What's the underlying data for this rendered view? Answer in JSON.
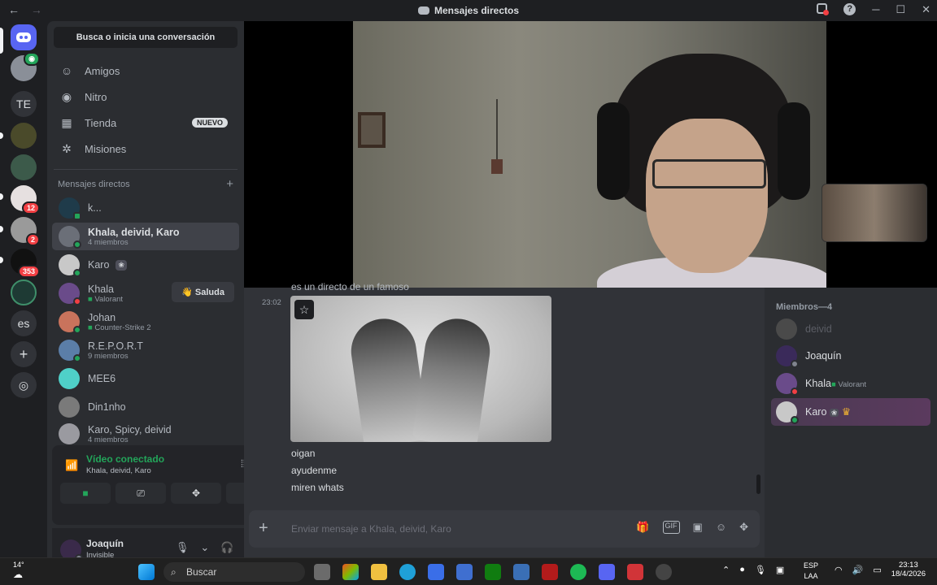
{
  "titlebar": {
    "back": "←",
    "forward": "→",
    "title": "Mensajes directos",
    "help": "?",
    "minimize": "─",
    "maximize": "☐",
    "close": "✕"
  },
  "rail": {
    "te": "TE",
    "es": "es",
    "badges": [
      "12",
      "2",
      "353"
    ],
    "add": "+",
    "explore": "◎"
  },
  "sidebar": {
    "search": "Busca o inicia una conversación",
    "nav": [
      {
        "label": "Amigos",
        "icon": "friends-icon"
      },
      {
        "label": "Nitro",
        "icon": "nitro-icon"
      },
      {
        "label": "Tienda",
        "icon": "shop-icon",
        "tag": "NUEVO"
      },
      {
        "label": "Misiones",
        "icon": "quests-icon"
      }
    ],
    "dm_header": "Mensajes directos",
    "dm_add": "+",
    "dms": [
      {
        "name": "k...",
        "sub": ""
      },
      {
        "name": "Khala, deivid, Karo",
        "sub": "4 miembros"
      },
      {
        "name": "Karo",
        "sub": ""
      },
      {
        "name": "Khala",
        "sub": "Valorant",
        "action": "Saluda"
      },
      {
        "name": "Johan",
        "sub": "Counter-Strike 2"
      },
      {
        "name": "R.E.P.O.R.T",
        "sub": "9 miembros"
      },
      {
        "name": "MEE6",
        "sub": ""
      },
      {
        "name": "Din1nho",
        "sub": ""
      },
      {
        "name": "Karo, Spicy, deivid",
        "sub": "4 miembros"
      }
    ],
    "wave_emoji": "👋"
  },
  "voice": {
    "title": "Vídeo conectado",
    "sub": "Khala, deivid, Karo"
  },
  "user": {
    "name": "Joaquín",
    "status": "Invisible"
  },
  "chat": {
    "partial_top": "es un directo de un famoso",
    "timestamp": "23:02",
    "messages": [
      "oigan",
      "ayudenme",
      "miren whats"
    ],
    "placeholder": "Enviar mensaje a Khala, deivid, Karo"
  },
  "members": {
    "header": "Miembros—4",
    "list": [
      {
        "name": "deivid",
        "sub": "",
        "offline": true
      },
      {
        "name": "Joaquín",
        "sub": ""
      },
      {
        "name": "Khala",
        "sub": "Valorant"
      },
      {
        "name": "Karo",
        "sub": ""
      }
    ]
  },
  "taskbar": {
    "temp": "14°",
    "search": "Buscar",
    "lang1": "ESP",
    "lang2": "LAA",
    "time": "23:13",
    "date": "18/4/2026"
  },
  "colors": {
    "accent": "#5865f2",
    "online": "#23a55a",
    "danger": "#f23f43"
  }
}
